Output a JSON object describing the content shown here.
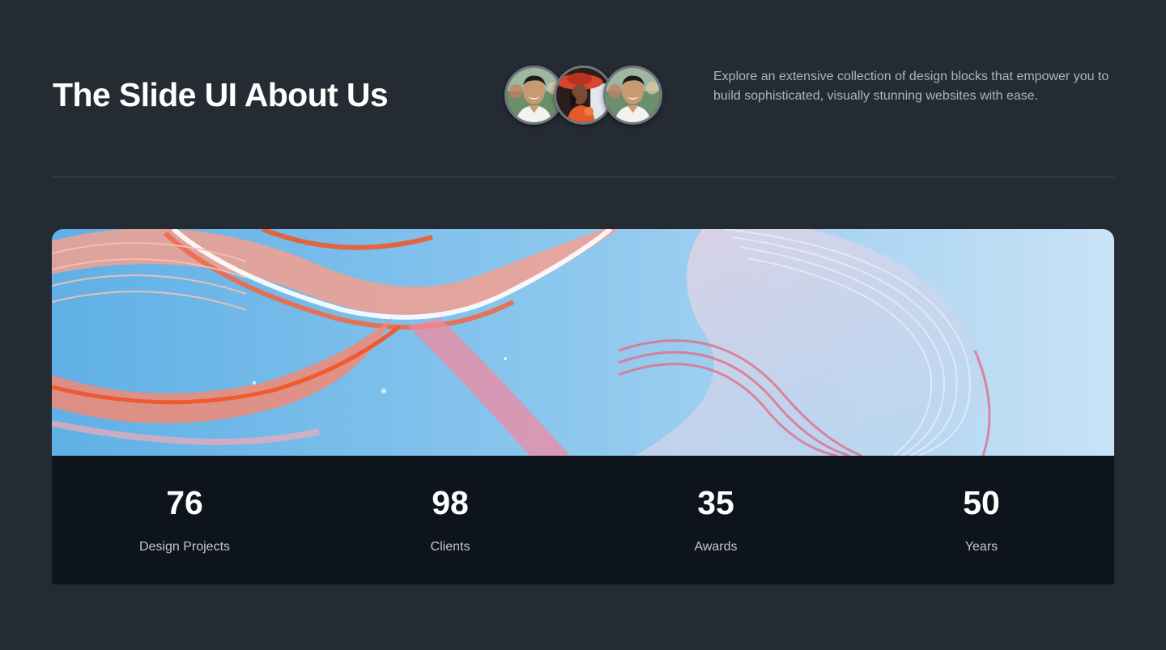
{
  "header": {
    "title": "The Slide UI About Us",
    "description": "Explore an extensive collection of design blocks that empower you to build sophisticated, visually stunning websites with ease."
  },
  "team_avatars": [
    {
      "name": "avatar-smiling-man"
    },
    {
      "name": "avatar-woman-red-hat"
    },
    {
      "name": "avatar-smiling-man"
    }
  ],
  "stats": [
    {
      "value": "76",
      "label": "Design Projects"
    },
    {
      "value": "98",
      "label": "Clients"
    },
    {
      "value": "35",
      "label": "Awards"
    },
    {
      "value": "50",
      "label": "Years"
    }
  ],
  "colors": {
    "background": "#252b32",
    "stats_background": "#0e141b",
    "title_text": "#ffffff",
    "body_text": "#aeb4bc"
  }
}
